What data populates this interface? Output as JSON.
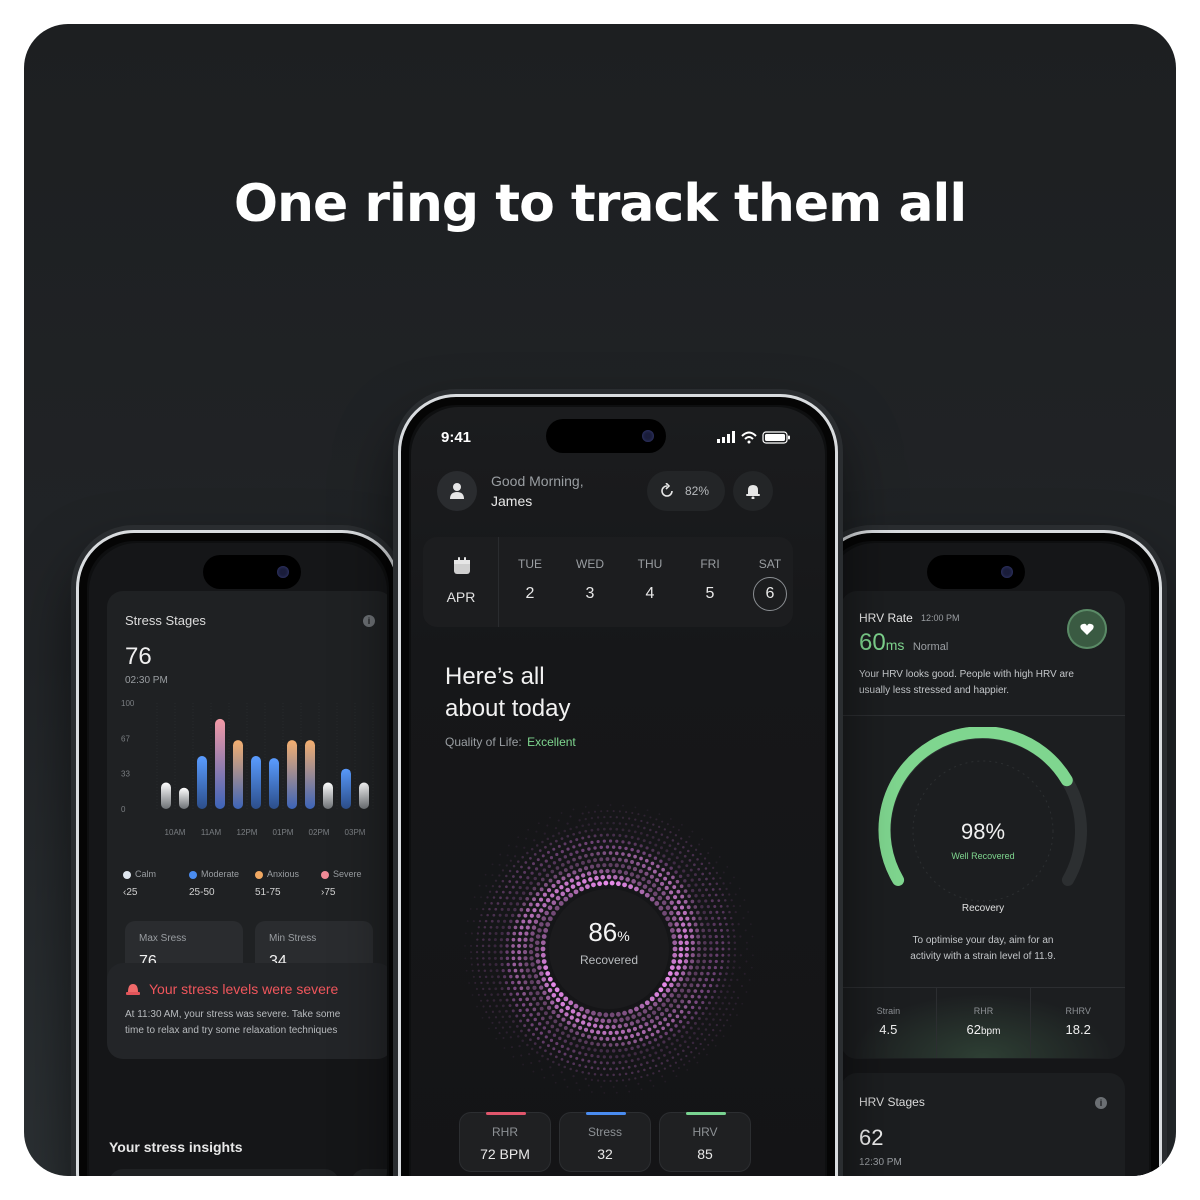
{
  "headline": "One ring to track them all",
  "left_phone": {
    "stress_title": "Stress Stages",
    "stress_value": "76",
    "stress_time": "02:30 PM",
    "y_ticks": [
      "100",
      "67",
      "33",
      "0"
    ],
    "x_ticks": [
      "10AM",
      "11AM",
      "12PM",
      "01PM",
      "02PM",
      "03PM"
    ],
    "legend": [
      {
        "label": "Calm",
        "range": "‹25",
        "color": "#dfe6ee"
      },
      {
        "label": "Moderate",
        "range": "25-50",
        "color": "#4a8cf0"
      },
      {
        "label": "Anxious",
        "range": "51-75",
        "color": "#f0a862"
      },
      {
        "label": "Severe",
        "range": "›75",
        "color": "#f08a96"
      }
    ],
    "bars": [
      {
        "value": 25,
        "color": "calm"
      },
      {
        "value": 20,
        "color": "calm"
      },
      {
        "value": 50,
        "color": "moderate"
      },
      {
        "value": 85,
        "color": "severe"
      },
      {
        "value": 65,
        "color": "anxious"
      },
      {
        "value": 50,
        "color": "moderate"
      },
      {
        "value": 48,
        "color": "moderate"
      },
      {
        "value": 65,
        "color": "anxious"
      },
      {
        "value": 65,
        "color": "anxious"
      },
      {
        "value": 25,
        "color": "calm"
      },
      {
        "value": 38,
        "color": "moderate"
      },
      {
        "value": 25,
        "color": "calm"
      }
    ],
    "max_label": "Max Sress",
    "max_value": "76",
    "min_label": "Min Stress",
    "min_value": "34",
    "alert_title": "Your stress levels were severe",
    "alert_body_1": "At 11:30 AM, your stress was severe. Take some",
    "alert_body_2": "time to relax and try some relaxation techniques",
    "insights_title": "Your stress insights"
  },
  "center_phone": {
    "time": "9:41",
    "greeting": "Good Morning,",
    "user_name": "James",
    "battery_pct": "82%",
    "month": "APR",
    "days": [
      {
        "name": "TUE",
        "num": "2"
      },
      {
        "name": "WED",
        "num": "3"
      },
      {
        "name": "THU",
        "num": "4"
      },
      {
        "name": "FRI",
        "num": "5"
      },
      {
        "name": "SAT",
        "num": "6"
      }
    ],
    "heading_line1": "Here’s all",
    "heading_line2": "about today",
    "quality_label": "Quality of Life:",
    "quality_value": "Excellent",
    "recovered_value": "86",
    "recovered_unit": "%",
    "recovered_label": "Recovered",
    "tiles": [
      {
        "label": "RHR",
        "value": "72 BPM",
        "color": "#e0566c"
      },
      {
        "label": "Stress",
        "value": "32",
        "color": "#4a8cf0"
      },
      {
        "label": "HRV",
        "value": "85",
        "color": "#79d391"
      }
    ]
  },
  "right_phone": {
    "hrv_title": "HRV Rate",
    "hrv_time": "12:00 PM",
    "hrv_value": "60",
    "hrv_unit": "ms",
    "hrv_status": "Normal",
    "hrv_desc_1": "Your HRV looks good. People with high HRV are",
    "hrv_desc_2": "usually less stressed and happier.",
    "recovery_pct": 98,
    "recovery_text": "98%",
    "recovery_status": "Well Recovered",
    "recovery_label": "Recovery",
    "tip_1": "To optimise your day, aim for an",
    "tip_2": "activity with a strain level of 11.9.",
    "stats": [
      {
        "label": "Strain",
        "value": "4.5",
        "unit": ""
      },
      {
        "label": "RHR",
        "value": "62",
        "unit": "bpm"
      },
      {
        "label": "RHRV",
        "value": "18.2",
        "unit": ""
      }
    ],
    "stages_title": "HRV Stages",
    "stages_value": "62",
    "stages_time": "12:30 PM"
  },
  "colors": {
    "accent_green": "#7fd68f",
    "severe_red": "#f0565c"
  }
}
